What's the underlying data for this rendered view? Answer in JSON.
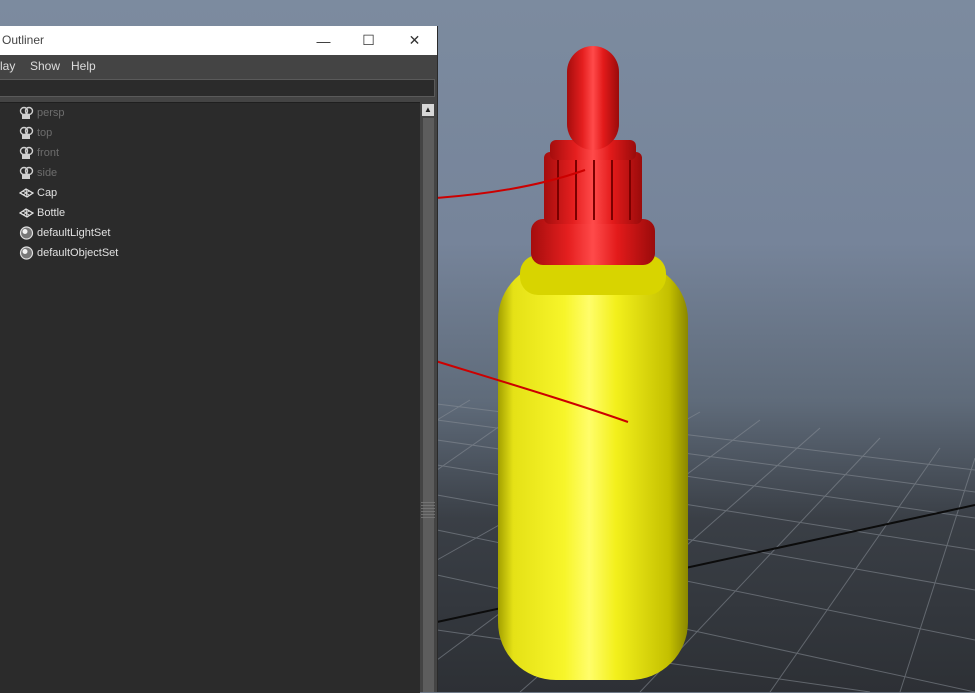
{
  "window": {
    "title": "Outliner",
    "controls": {
      "minimize": "—",
      "maximize": "☐",
      "close": "✕"
    }
  },
  "menu": {
    "items": [
      "lay",
      "Show",
      "Help"
    ]
  },
  "search": {
    "value": "",
    "placeholder": ""
  },
  "outliner": {
    "items": [
      {
        "label": "persp",
        "icon": "camera-icon",
        "dimmed": true
      },
      {
        "label": "top",
        "icon": "camera-icon",
        "dimmed": true
      },
      {
        "label": "front",
        "icon": "camera-icon",
        "dimmed": true
      },
      {
        "label": "side",
        "icon": "camera-icon",
        "dimmed": true
      },
      {
        "label": "Cap",
        "icon": "mesh-transform-icon",
        "dimmed": false
      },
      {
        "label": "Bottle",
        "icon": "mesh-transform-icon",
        "dimmed": false
      },
      {
        "label": "defaultLightSet",
        "icon": "set-sphere-icon",
        "dimmed": false
      },
      {
        "label": "defaultObjectSet",
        "icon": "set-sphere-icon",
        "dimmed": false
      }
    ]
  },
  "scrollbar": {
    "up_arrow": "▲"
  },
  "colors": {
    "cap": "#e02020",
    "bottle": "#f2ee10",
    "annotation": "#cc0000",
    "panel_bg": "#2b2b2b",
    "menu_bg": "#444444"
  }
}
